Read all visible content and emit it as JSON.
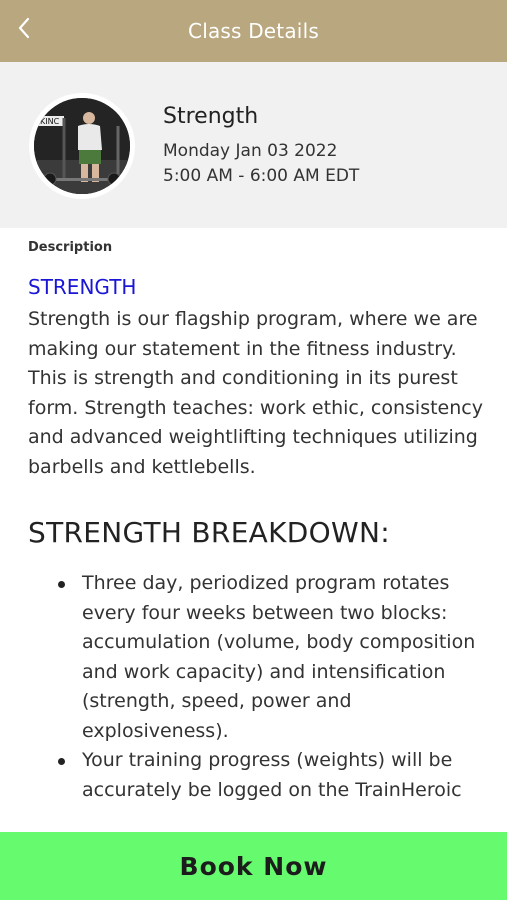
{
  "header": {
    "title": "Class Details",
    "back_icon": "chevron-left-icon"
  },
  "class": {
    "name": "Strength",
    "date": "Monday Jan 03 2022",
    "time": "5:00 AM - 6:00 AM EDT"
  },
  "description": {
    "label": "Description",
    "heading": "STRENGTH",
    "text": "Strength is our flagship program, where we are making our statement in the fitness industry. This is strength and conditioning in its purest form. Strength teaches: work ethic, consistency and advanced weightlifting techniques utilizing barbells and kettlebells.",
    "breakdown_title": "STRENGTH BREAKDOWN:",
    "bullets": [
      "Three day, periodized program rotates every four weeks between two blocks: accumulation (volume, body composition and work capacity) and intensification (strength, speed, power and explosiveness).",
      "Your training progress (weights) will be accurately be logged on the TrainHeroic"
    ]
  },
  "footer": {
    "book_label": "Book Now"
  },
  "colors": {
    "header_bg": "#b9a77f",
    "card_bg": "#f1f1f1",
    "heading_blue": "#1a16d6",
    "book_green": "#66fa6f"
  }
}
